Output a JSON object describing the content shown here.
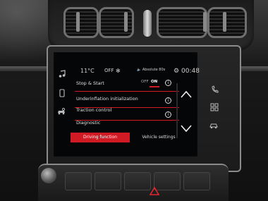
{
  "status_bar": {
    "temperature": "11°C",
    "ac_state": "OFF",
    "fan_icon": "fan-icon",
    "audio_source": "Absolute 80s",
    "settings_icon": "gear-icon",
    "clock": "00:48"
  },
  "settings_list": [
    {
      "label": "Stop & Start",
      "has_toggle": true,
      "toggle_off": "OFF",
      "toggle_on": "ON",
      "toggle_value": "ON"
    },
    {
      "label": "Underinflation initialization",
      "has_toggle": false
    },
    {
      "label": "Traction control",
      "has_toggle": false
    },
    {
      "label": "Diagnostic",
      "has_toggle": false
    }
  ],
  "tabs": {
    "active": "Driving function",
    "inactive": "Vehicle settings"
  },
  "colors": {
    "accent": "#d01a24",
    "screen_bg": "#050607",
    "text": "#e0e0e0"
  },
  "side_keys_left": [
    "music-note-icon",
    "phone-icon",
    "car-settings-icon"
  ],
  "side_keys_right": [
    "phone-handset-icon",
    "grid-apps-icon",
    "car-icon"
  ]
}
